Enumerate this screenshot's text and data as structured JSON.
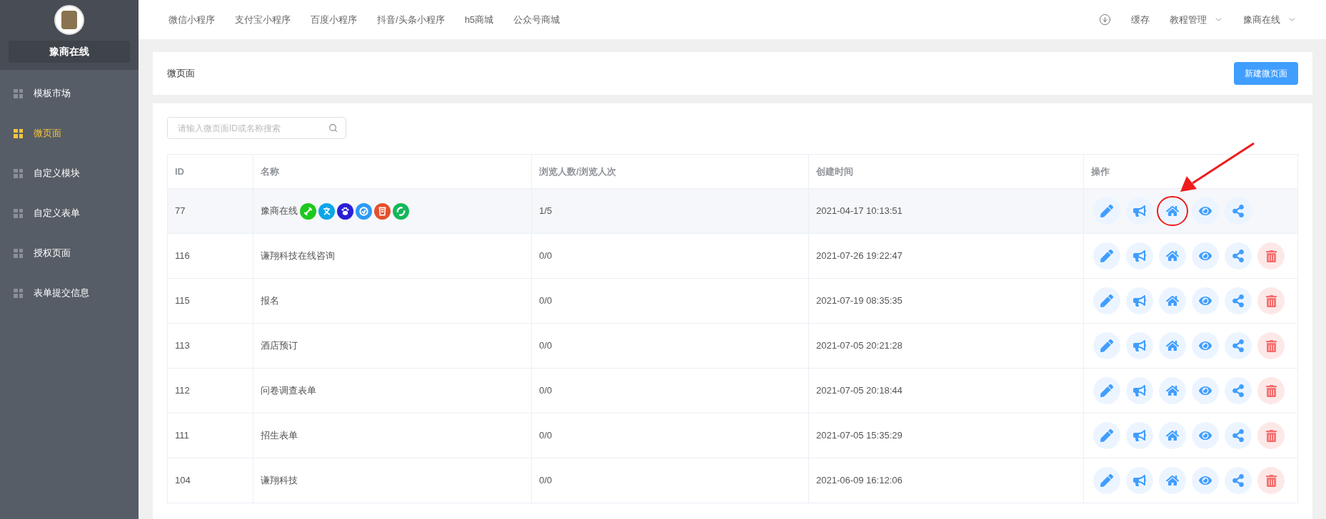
{
  "sidebar": {
    "brand": "豫商在线",
    "items": [
      {
        "label": "模板市场",
        "selected": false
      },
      {
        "label": "微页面",
        "selected": true
      },
      {
        "label": "自定义模块",
        "selected": false
      },
      {
        "label": "自定义表单",
        "selected": false
      },
      {
        "label": "授权页面",
        "selected": false
      },
      {
        "label": "表单提交信息",
        "selected": false
      }
    ]
  },
  "top_nav": {
    "items": [
      "微信小程序",
      "支付宝小程序",
      "百度小程序",
      "抖音/头条小程序",
      "h5商城",
      "公众号商城"
    ],
    "right": [
      {
        "kind": "icon"
      },
      {
        "kind": "link",
        "label": "缓存"
      },
      {
        "kind": "menu",
        "label": "教程管理"
      },
      {
        "kind": "menu",
        "label": "豫商在线"
      }
    ]
  },
  "page_header": {
    "title": "微页面",
    "button": "新建微页面"
  },
  "search": {
    "placeholder": "请输入微页面ID或名称搜索"
  },
  "table": {
    "columns": [
      "ID",
      "名称",
      "浏览人数/浏览人次",
      "创建时间",
      "操作"
    ],
    "rows": [
      {
        "id": "77",
        "name": "豫商在线",
        "views": "1/5",
        "created": "2021-04-17 10:13:51",
        "selected": true,
        "deletable": false,
        "marked": true,
        "platforms": [
          {
            "kind": "link",
            "color": "#1dc91d"
          },
          {
            "kind": "character",
            "color": "#0ba5e9"
          },
          {
            "kind": "paw",
            "color": "#2a1fd6"
          },
          {
            "kind": "ring",
            "color": "#2c9af5"
          },
          {
            "kind": "document",
            "color": "#e4502c"
          },
          {
            "kind": "recycle",
            "color": "#14b75a"
          }
        ]
      },
      {
        "id": "116",
        "name": "谦翔科技在线咨询",
        "views": "0/0",
        "created": "2021-07-26 19:22:47",
        "selected": false,
        "deletable": true,
        "marked": false,
        "platforms": []
      },
      {
        "id": "115",
        "name": "报名",
        "views": "0/0",
        "created": "2021-07-19 08:35:35",
        "selected": false,
        "deletable": true,
        "marked": false,
        "platforms": []
      },
      {
        "id": "113",
        "name": "酒店预订",
        "views": "0/0",
        "created": "2021-07-05 20:21:28",
        "selected": false,
        "deletable": true,
        "marked": false,
        "platforms": []
      },
      {
        "id": "112",
        "name": "问卷调查表单",
        "views": "0/0",
        "created": "2021-07-05 20:18:44",
        "selected": false,
        "deletable": true,
        "marked": false,
        "platforms": []
      },
      {
        "id": "111",
        "name": "招生表单",
        "views": "0/0",
        "created": "2021-07-05 15:35:29",
        "selected": false,
        "deletable": true,
        "marked": false,
        "platforms": []
      },
      {
        "id": "104",
        "name": "谦翔科技",
        "views": "0/0",
        "created": "2021-06-09 16:12:06",
        "selected": false,
        "deletable": true,
        "marked": false,
        "platforms": []
      }
    ]
  }
}
